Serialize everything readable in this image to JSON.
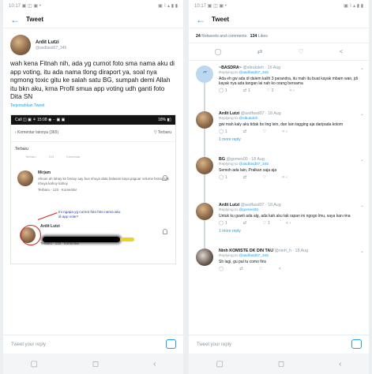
{
  "left": {
    "status_left": "10:17 ▣ ◫ ▣ •",
    "status_right": "▣ ⌇ ▴ ▮ ▮",
    "title": "Tweet",
    "author_name": "Ardit Lutzi",
    "author_handle": "@asdfasd07_345",
    "tweet_text": "wah kena Fitnah nih, ada yg curnot foto sma nama aku di app voting, itu ada nama tlong diraport ya, soal nya ngmong toxic gitu ke salah satu BG, sumpah demi Allah itu bkn aku, krna Profil smua app voting udh ganti foto Dita SN",
    "translate": "Terjemahkan Tweet",
    "inner": {
      "status_left": "Call ◫ ▣ ⚘ 15:08 ◉ ··  ▣ ▣",
      "status_right": "18% ▮▯",
      "header_left": "‹  Komentar lainnya (365)",
      "header_right": "▽ Terbaru",
      "terbaru": "Terbaru",
      "action_1": "Terbaru",
      "action_2": "123",
      "action_3": "Komentar",
      "c1_name": "Mirjam",
      "c1_text": "Ahsan ah lahay ke bsnay aay bus nhuya data balasan kaya paguar volume bsnay tak nhuya kahuy kahuy",
      "c1_meta": "Terbaru · 123 · Komentar",
      "c2_name": "Ardit Lutzi",
      "c2_meta": "Terbaru · 123 · Komentar",
      "annotation": "Ini ngapa yg curnot foto foto nama aku di app vote?"
    },
    "reply_placeholder": "Tweet your reply"
  },
  "right": {
    "status_left": "10:17 ▣ ◫ ▣ •",
    "status_right": "▣ ⌇ ▴ ▮ ▮",
    "title": "Tweet",
    "retweets_count": "24",
    "retweets_label": "Retweets and comments",
    "likes_count": "134",
    "likes_label": "Likes",
    "replies": [
      {
        "name": "~BASDRA~",
        "handle": "@sibukdeh · 16 Aug",
        "replying": "Replying to",
        "mention": "@asdfasd07_345",
        "text": "Ada eh gw ada di dalem kalih 3 parandra, itu mah itu buat kayak mbam wan, jdi kayak nya ada tangan lai nah ko orang bersama",
        "actions": [
          "1",
          "1",
          "3",
          "‹"
        ],
        "avatar": "emoji",
        "show_replies": ""
      },
      {
        "name": "Ardit Lutzi",
        "handle": "@asdfasd07 · 18 Aug",
        "replying": "Replying to",
        "mention": "@sibukdeh",
        "text": "gwi mah kaly aku tidak bs ling lein, dan lain tagging aja daripada kolom",
        "actions": [
          "1",
          "",
          "",
          "‹"
        ],
        "avatar": "photo",
        "show_replies": "1 more reply"
      },
      {
        "name": "BG",
        "handle": "@gomes00 · 18 Aug",
        "replying": "Replying to",
        "mention": "@asdfasd07_345",
        "text": "Semoh ada lain, Pralkan saja aja",
        "actions": [
          "1",
          "",
          "",
          "‹"
        ],
        "avatar": "photo",
        "show_replies": ""
      },
      {
        "name": "Ardit Lutzi",
        "handle": "@asdfasd07 · 18 Aug",
        "replying": "Replying to",
        "mention": "@gomes00",
        "text": "Untuk ku guwti ada alg, ada kah aku tak rapan ini ngogo lmu, saya kan rina",
        "actions": [
          "1",
          "",
          "1",
          "‹"
        ],
        "avatar": "photo",
        "show_replies": "1 more reply"
      },
      {
        "name": "Ninh KOMISTE DK DIN TAU",
        "handle": "@ninh_h · 18 Aug",
        "replying": "Replying to",
        "mention": "@asdfasd07_345",
        "text": "Sh lagi, gu pal tu como fins",
        "actions": [
          "",
          "",
          "",
          ""
        ],
        "avatar": "dark",
        "show_replies": ""
      }
    ],
    "reply_placeholder": "Tweet your reply"
  },
  "nav": {
    "back": "▢",
    "home": "◻",
    "recent": "‹"
  },
  "icons": {
    "back": "arrow-left-icon",
    "reply": "comment-icon",
    "retweet": "retweet-icon",
    "like": "heart-icon",
    "share": "share-icon",
    "camera": "camera-icon",
    "bell": "bell-icon"
  },
  "colors": {
    "accent": "#1da1f2",
    "annotation_red": "#e02020",
    "annotation_blue": "#2040c0"
  }
}
